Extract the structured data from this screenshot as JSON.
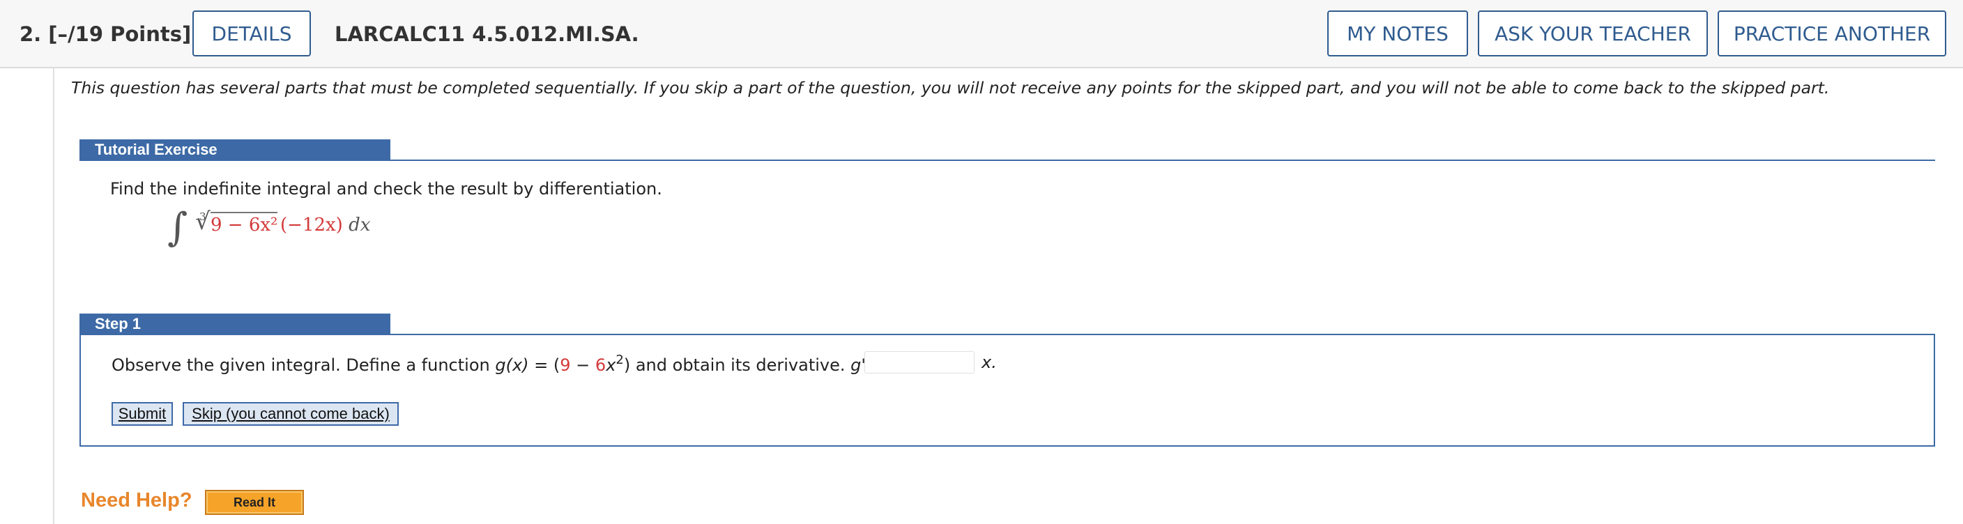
{
  "header": {
    "question_label": "2.  [–/19 Points]",
    "details_label": "DETAILS",
    "question_id": "LARCALC11 4.5.012.MI.SA.",
    "my_notes_label": "MY NOTES",
    "ask_teacher_label": "ASK YOUR TEACHER",
    "practice_label": "PRACTICE ANOTHER"
  },
  "intro_text": "This question has several parts that must be completed sequentially. If you skip a part of the question, you will not receive any points for the skipped part, and you will not be able to come back to the skipped part.",
  "tutorial": {
    "title": "Tutorial Exercise",
    "prompt": "Find the indefinite integral and check the result by differentiation.",
    "integral": {
      "sign": "∫",
      "root_index": "3",
      "root_symbol": "√",
      "radicand": "9 − 6x²",
      "factor": "(−12x)",
      "dx": " dx"
    }
  },
  "step1": {
    "title": "Step 1",
    "text_before": "Observe the given integral. Define a function ",
    "g_of_x": "g(x)",
    "equals_open": " = (",
    "nine": "9",
    "minus": " − ",
    "six": "6",
    "x_var": "x",
    "exp": "2",
    "close_text": ") and obtain its derivative. ",
    "g_prime": "g'(x)",
    "equals": " = ",
    "answer_value": "",
    "unit": "x.",
    "submit_label": "Submit",
    "skip_label": "Skip (you cannot come back)"
  },
  "help": {
    "label": "Need Help?",
    "read_it_label": "Read It"
  },
  "colors": {
    "accent_blue": "#3d6aa6",
    "button_blue": "#2f5b8f",
    "highlight_red": "#d33a3a",
    "help_orange": "#e8862b",
    "read_it_fill": "#f6a329"
  }
}
